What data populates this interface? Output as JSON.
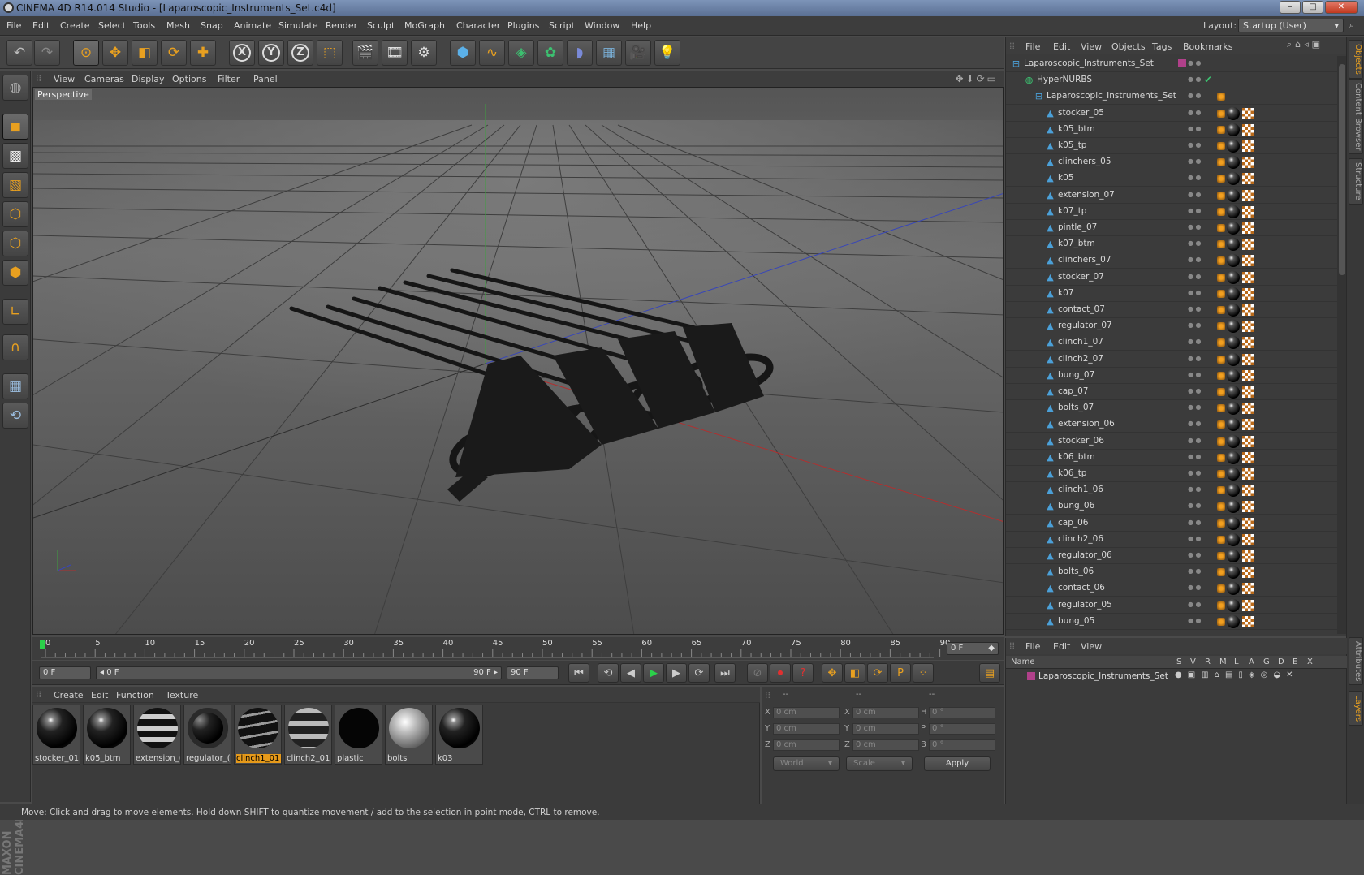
{
  "window": {
    "title": "CINEMA 4D R14.014 Studio - [Laparoscopic_Instruments_Set.c4d]",
    "min": "–",
    "max": "□",
    "close": "✕"
  },
  "menu": [
    "File",
    "Edit",
    "Create",
    "Select",
    "Tools",
    "Mesh",
    "Snap",
    "Animate",
    "Simulate",
    "Render",
    "Sculpt",
    "MoGraph",
    "Character",
    "Plugins",
    "Script",
    "Window",
    "Help"
  ],
  "layout": {
    "label": "Layout:",
    "value": "Startup (User)"
  },
  "viewport": {
    "menu": [
      "View",
      "Cameras",
      "Display",
      "Options",
      "Filter",
      "Panel"
    ],
    "label": "Perspective",
    "icons": "✥⬇⟳▭"
  },
  "timeline": {
    "ticks": [
      "0",
      "5",
      "10",
      "15",
      "20",
      "25",
      "30",
      "35",
      "40",
      "45",
      "50",
      "55",
      "60",
      "65",
      "70",
      "75",
      "80",
      "85",
      "90"
    ],
    "frame_field": "0 F"
  },
  "transport": {
    "start": "0 F",
    "range_start": "◂ 0 F",
    "range_end": "90 F ▸",
    "end": "90 F"
  },
  "materials": {
    "menu": [
      "Create",
      "Edit",
      "Function",
      "Texture"
    ],
    "items": [
      "stocker_01",
      "k05_btm",
      "extension_(",
      "regulator_(",
      "clinch1_01",
      "clinch2_01",
      "plastic",
      "bolts",
      "k03"
    ]
  },
  "coords": {
    "headers": [
      "--",
      "--",
      "--"
    ],
    "rows": [
      [
        "X",
        "0 cm",
        "X",
        "0 cm",
        "H",
        "0 °"
      ],
      [
        "Y",
        "0 cm",
        "Y",
        "0 cm",
        "P",
        "0 °"
      ],
      [
        "Z",
        "0 cm",
        "Z",
        "0 cm",
        "B",
        "0 °"
      ]
    ],
    "world": "World",
    "scale": "Scale",
    "apply": "Apply"
  },
  "objects": {
    "menu": [
      "File",
      "Edit",
      "View",
      "Objects",
      "Tags",
      "Bookmarks"
    ],
    "items": [
      "Laparoscopic_Instruments_Set",
      "HyperNURBS",
      "Laparoscopic_Instruments_Set",
      "stocker_05",
      "k05_btm",
      "k05_tp",
      "clinchers_05",
      "k05",
      "extension_07",
      "k07_tp",
      "pintle_07",
      "k07_btm",
      "clinchers_07",
      "stocker_07",
      "k07",
      "contact_07",
      "regulator_07",
      "clinch1_07",
      "clinch2_07",
      "bung_07",
      "cap_07",
      "bolts_07",
      "extension_06",
      "stocker_06",
      "k06_btm",
      "k06_tp",
      "clinch1_06",
      "bung_06",
      "cap_06",
      "clinch2_06",
      "regulator_06",
      "bolts_06",
      "contact_06",
      "regulator_05",
      "bung_05"
    ]
  },
  "sidetabs": [
    "Objects",
    "Content Browser",
    "Structure",
    "Attributes",
    "Layers"
  ],
  "layers": {
    "menu": [
      "File",
      "Edit",
      "View"
    ],
    "columns": [
      "Name",
      "S",
      "V",
      "R",
      "M",
      "L",
      "A",
      "G",
      "D",
      "E",
      "X"
    ],
    "row": "Laparoscopic_Instruments_Set"
  },
  "status": "Move: Click and drag to move elements. Hold down SHIFT to quantize movement / add to the selection in point mode, CTRL to remove.",
  "colors": {
    "accent": "#e69a1a",
    "x_axis": "#c03030",
    "y_axis": "#30b030",
    "z_axis": "#3040c0"
  }
}
